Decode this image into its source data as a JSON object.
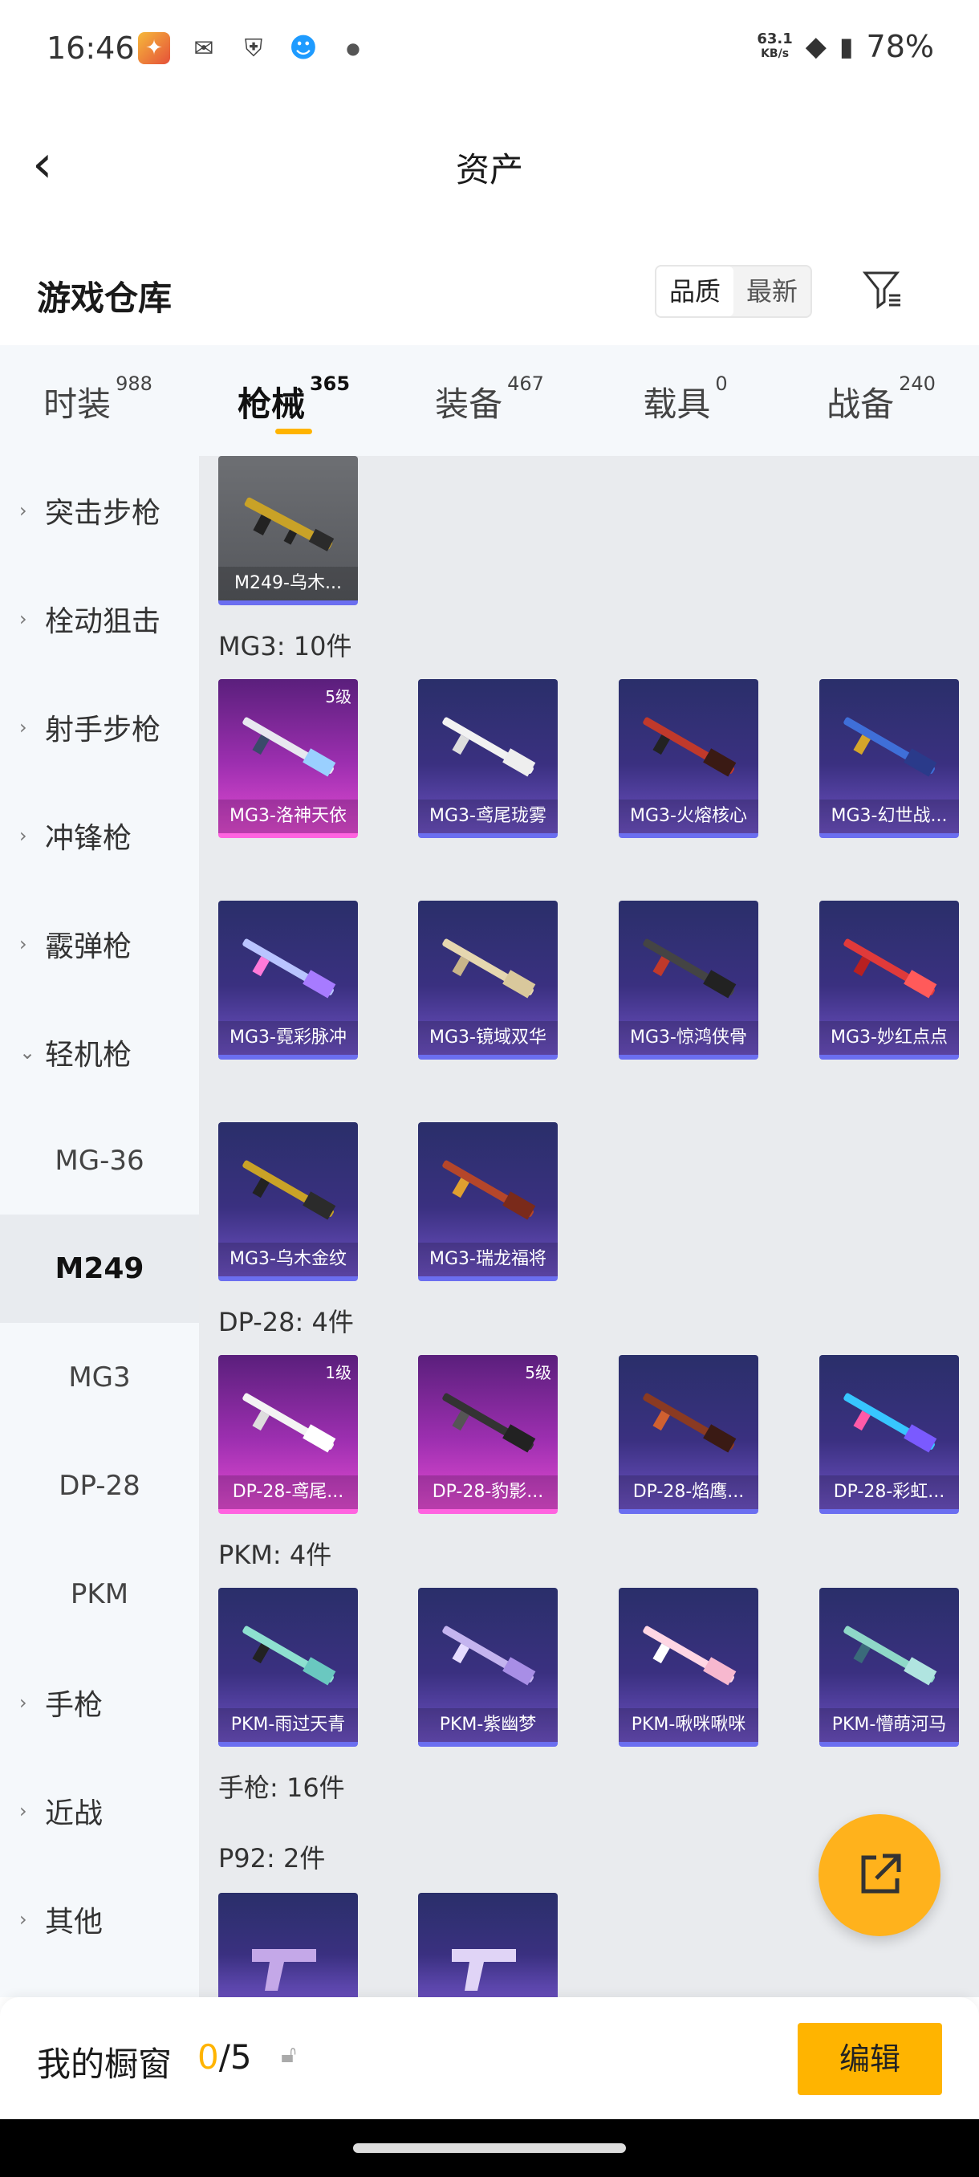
{
  "status_bar": {
    "time": "16:46",
    "speed_value": "63.1",
    "speed_unit": "KB/s",
    "battery": "78%"
  },
  "header": {
    "title": "资产"
  },
  "section": {
    "title": "游戏仓库",
    "sort_quality": "品质",
    "sort_newest": "最新"
  },
  "tabs": [
    {
      "label": "时装",
      "count": "988"
    },
    {
      "label": "枪械",
      "count": "365"
    },
    {
      "label": "装备",
      "count": "467"
    },
    {
      "label": "载具",
      "count": "0"
    },
    {
      "label": "战备",
      "count": "240"
    }
  ],
  "sidebar": {
    "items": [
      {
        "label": "突击步枪"
      },
      {
        "label": "栓动狙击"
      },
      {
        "label": "射手步枪"
      },
      {
        "label": "冲锋枪"
      },
      {
        "label": "霰弹枪"
      },
      {
        "label": "轻机枪"
      },
      {
        "label": "MG-36"
      },
      {
        "label": "M249"
      },
      {
        "label": "MG3"
      },
      {
        "label": "DP-28"
      },
      {
        "label": "PKM"
      },
      {
        "label": "手枪"
      },
      {
        "label": "近战"
      },
      {
        "label": "其他"
      }
    ]
  },
  "groups": {
    "top": {
      "label": ""
    },
    "mg3": {
      "label": "MG3: 10件"
    },
    "dp28": {
      "label": "DP-28: 4件"
    },
    "pkm": {
      "label": "PKM: 4件"
    },
    "pistol": {
      "label": "手枪: 16件"
    },
    "p92": {
      "label": "P92: 2件"
    }
  },
  "cards": {
    "m249_1": {
      "name": "M249-乌木...",
      "level": ""
    },
    "mg3_1": {
      "name": "MG3-洛神天依",
      "level": "5级"
    },
    "mg3_2": {
      "name": "MG3-鸢尾珑雾",
      "level": ""
    },
    "mg3_3": {
      "name": "MG3-火熔核心",
      "level": ""
    },
    "mg3_4": {
      "name": "MG3-幻世战...",
      "level": ""
    },
    "mg3_5": {
      "name": "MG3-霓彩脉冲",
      "level": ""
    },
    "mg3_6": {
      "name": "MG3-镜域双华",
      "level": ""
    },
    "mg3_7": {
      "name": "MG3-惊鸿侠骨",
      "level": ""
    },
    "mg3_8": {
      "name": "MG3-妙红点点",
      "level": ""
    },
    "mg3_9": {
      "name": "MG3-乌木金纹",
      "level": ""
    },
    "mg3_10": {
      "name": "MG3-瑞龙福将",
      "level": ""
    },
    "dp_1": {
      "name": "DP-28-鸢尾...",
      "level": "1级"
    },
    "dp_2": {
      "name": "DP-28-豹影...",
      "level": "5级"
    },
    "dp_3": {
      "name": "DP-28-焰鹰...",
      "level": ""
    },
    "dp_4": {
      "name": "DP-28-彩虹...",
      "level": ""
    },
    "pkm_1": {
      "name": "PKM-雨过天青",
      "level": ""
    },
    "pkm_2": {
      "name": "PKM-紫幽梦",
      "level": ""
    },
    "pkm_3": {
      "name": "PKM-啾咪啾咪",
      "level": ""
    },
    "pkm_4": {
      "name": "PKM-懵萌河马",
      "level": ""
    }
  },
  "bottom_bar": {
    "title": "我的橱窗",
    "count_current": "0",
    "count_total": "/5",
    "edit_label": "编辑"
  },
  "colors": {
    "accent": "#ffb400",
    "card_purple": "#3a3080",
    "card_pink": "#9d2fb0"
  }
}
